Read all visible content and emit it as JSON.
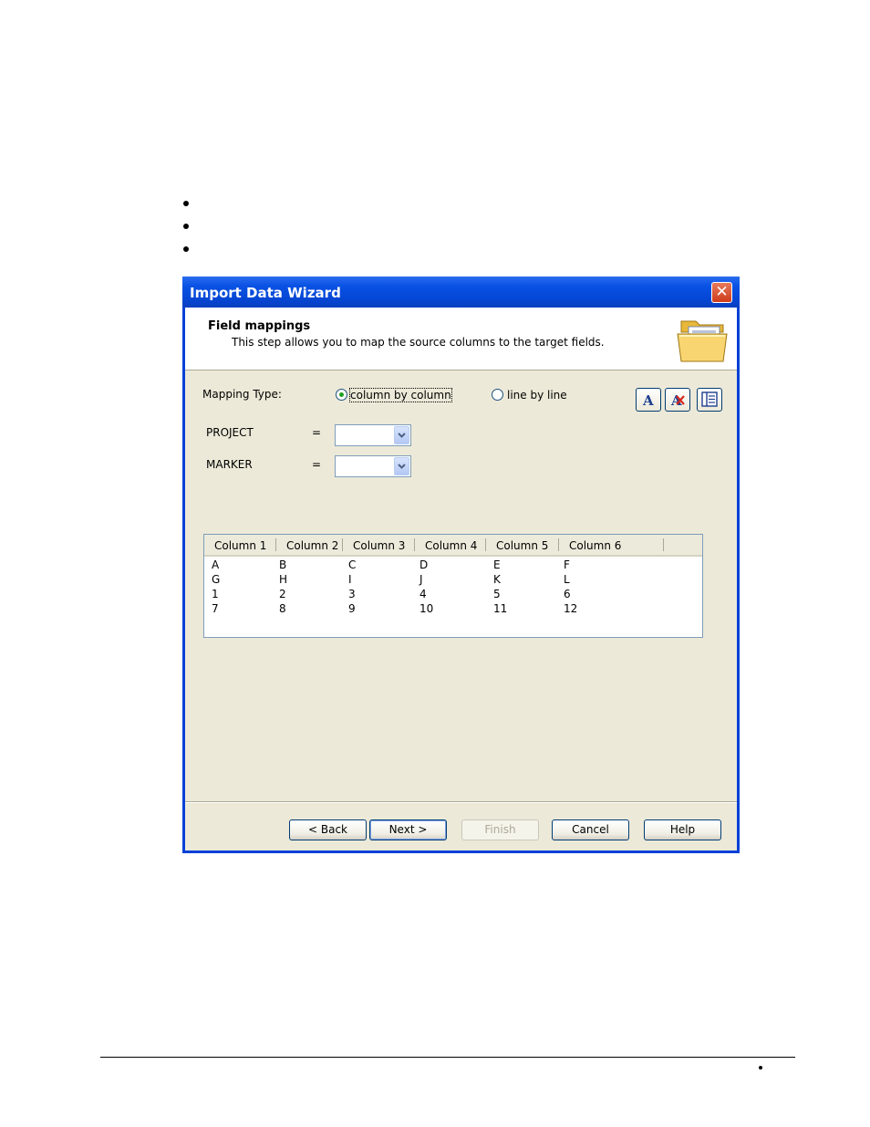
{
  "window": {
    "title": "Import Data Wizard",
    "close_glyph": "✕"
  },
  "header": {
    "title": "Field mappings",
    "subtitle": "This step allows you to map the source columns to the target fields.",
    "icon": "folder-icon"
  },
  "mapping": {
    "label": "Mapping Type:",
    "options": [
      {
        "label": "column by column",
        "selected": true
      },
      {
        "label": "line by line",
        "selected": false
      }
    ]
  },
  "toolbar": {
    "buttons": [
      "font-icon",
      "clear-font-icon",
      "layout-icon"
    ]
  },
  "fields": [
    {
      "name": "PROJECT",
      "eq": "=",
      "value": ""
    },
    {
      "name": "MARKER",
      "eq": "=",
      "value": ""
    }
  ],
  "grid": {
    "columns": [
      "Column 1",
      "Column 2",
      "Column 3",
      "Column 4",
      "Column 5",
      "Column 6"
    ],
    "rows": [
      [
        "A",
        "B",
        "C",
        "D",
        "E",
        "F"
      ],
      [
        "G",
        "H",
        "I",
        "J",
        "K",
        "L"
      ],
      [
        "1",
        "2",
        "3",
        "4",
        "5",
        "6"
      ],
      [
        "7",
        "8",
        "9",
        "10",
        "11",
        "12"
      ]
    ]
  },
  "buttons": {
    "back": "< Back",
    "next": "Next >",
    "finish": "Finish",
    "cancel": "Cancel",
    "help": "Help"
  },
  "colors": {
    "titlebar": "#0a52e4",
    "dialog_bg": "#ece9d8",
    "radio_selected": "#21a121"
  }
}
